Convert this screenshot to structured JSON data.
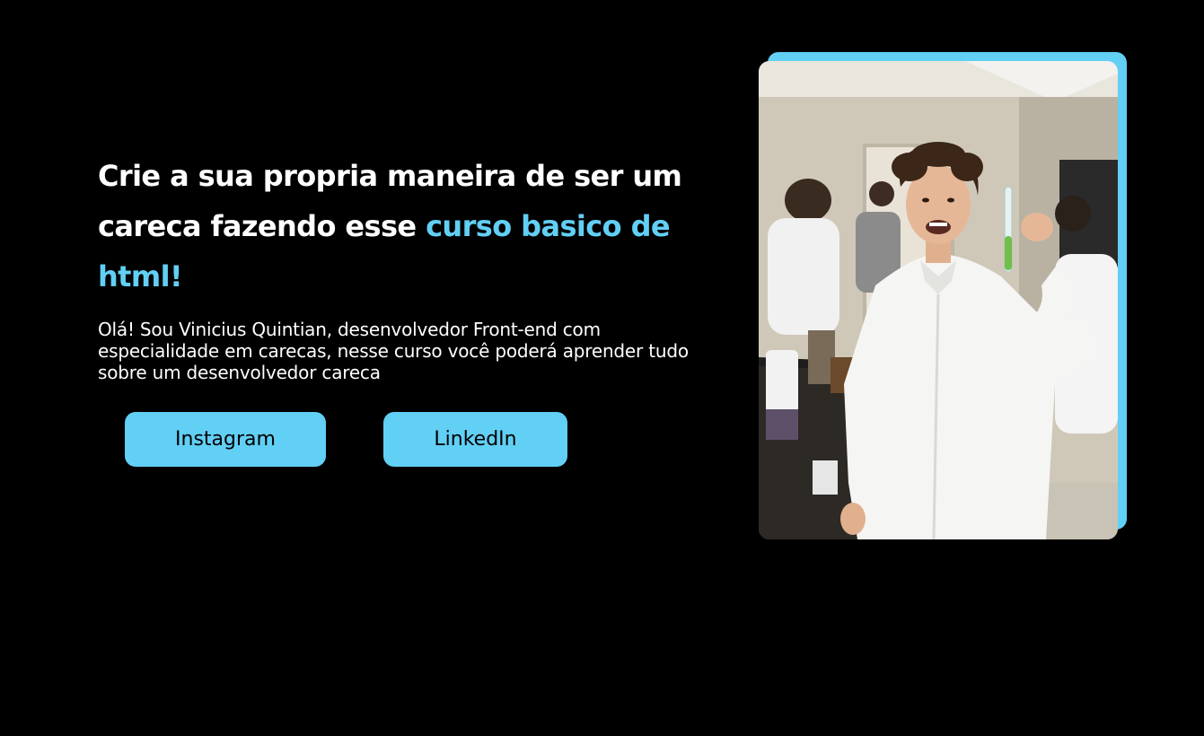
{
  "hero": {
    "headline_part1": "Crie a sua propria maneira de ser um careca fazendo esse ",
    "headline_accent": "curso basico de html!",
    "intro": "Olá! Sou Vinicius Quintian, desenvolvedor Front-end com especialidade em carecas, nesse curso você poderá aprender tudo sobre um desenvolvedor careca"
  },
  "buttons": {
    "instagram": "Instagram",
    "linkedin": "LinkedIn"
  },
  "colors": {
    "background": "#000000",
    "accent": "#62cff4",
    "text": "#ffffff"
  }
}
